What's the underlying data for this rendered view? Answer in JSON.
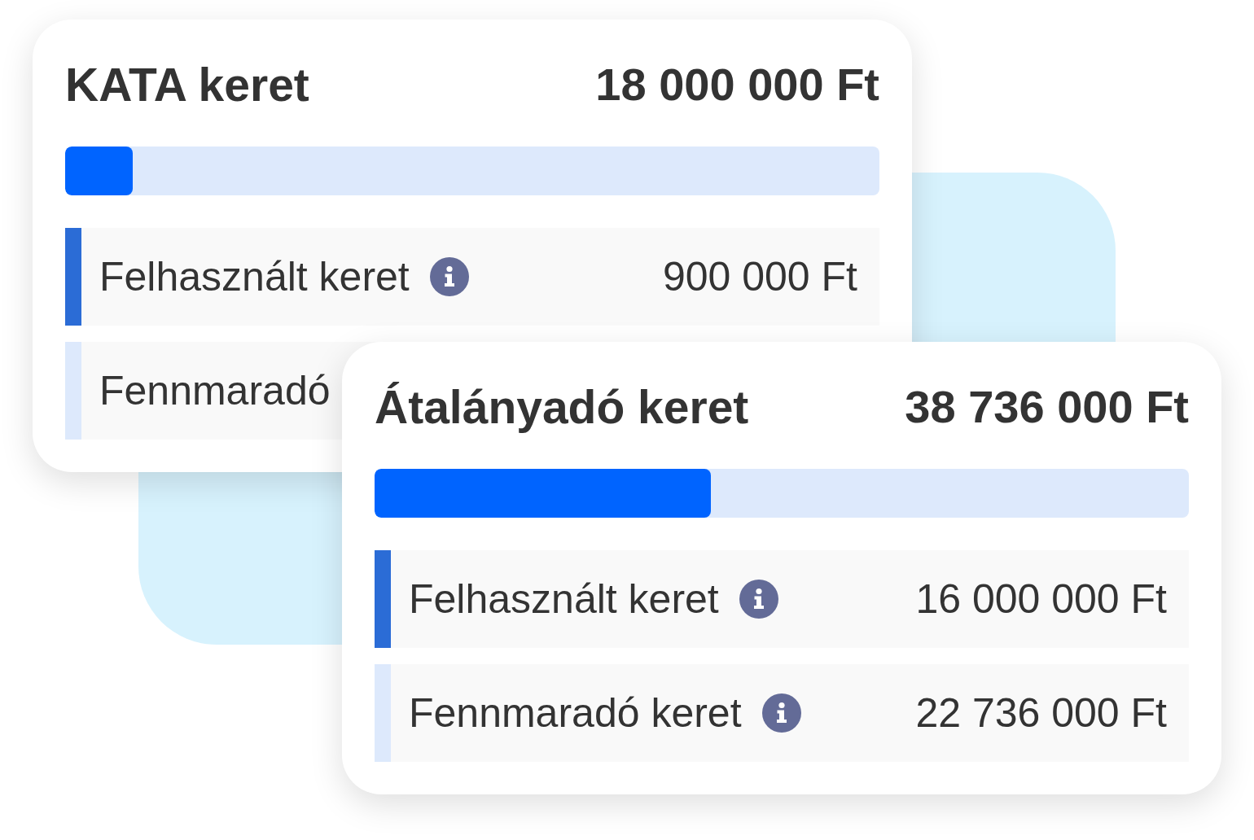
{
  "cards": [
    {
      "title": "KATA keret",
      "amount": "18 000 000 Ft",
      "level": 0.083,
      "rows": [
        {
          "label": "Felhasznált keret",
          "color": "#2b6cd6",
          "value": "900 000 Ft"
        },
        {
          "label": "Fennmaradó",
          "color": "#dde9fc"
        }
      ]
    },
    {
      "title": "Átalányadó keret",
      "amount": "38 736 000 Ft",
      "level": 0.413,
      "rows": [
        {
          "label": "Felhasznált keret",
          "color": "#2b6cd6",
          "value": "16 000 000 Ft"
        },
        {
          "label": "Fennmaradó keret",
          "color": "#dde9fc",
          "value": "22 736 000 Ft"
        }
      ]
    }
  ]
}
